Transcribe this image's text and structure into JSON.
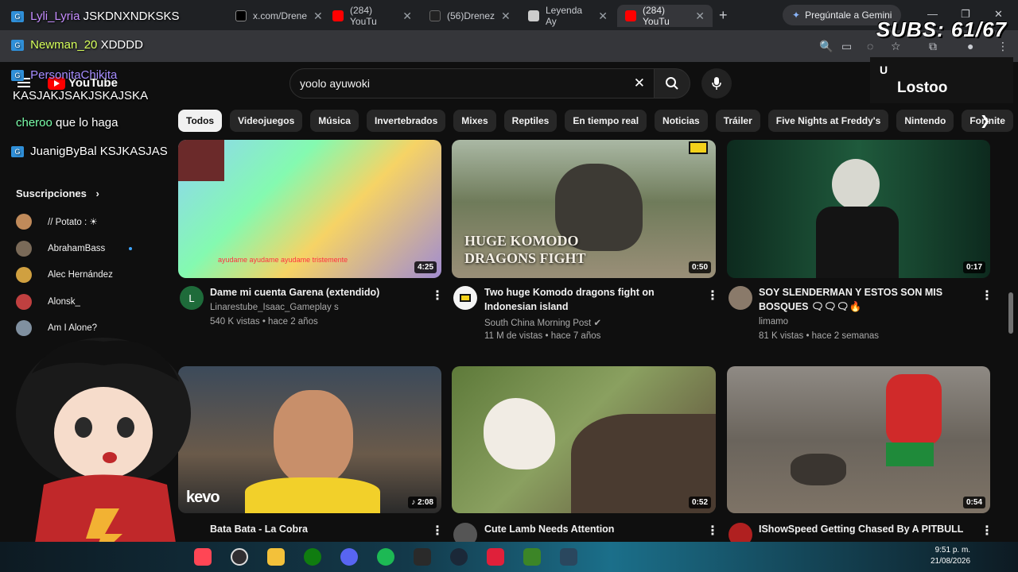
{
  "browser": {
    "tabs": [
      {
        "label": "x.com/Drene",
        "color": "#e8eaed"
      },
      {
        "label": "(284) YouTu",
        "color": "#ff0000"
      },
      {
        "label": "(56)Drenez",
        "color": "#222222"
      },
      {
        "label": "Leyenda Ay",
        "color": "#cccccc"
      },
      {
        "label": "(284) YouTu",
        "color": "#ff0000"
      }
    ],
    "gemini_label": "Pregúntale a Gemini"
  },
  "youtube": {
    "logo_text": "YouTube",
    "search": {
      "value": "yoolo ayuwoki"
    },
    "chips": [
      "Todos",
      "Videojuegos",
      "Música",
      "Invertebrados",
      "Mixes",
      "Reptiles",
      "En tiempo real",
      "Noticias",
      "Tráiler",
      "Five Nights at Freddy's",
      "Nintendo",
      "Fortnite"
    ],
    "sidebar": {
      "section_title": "Suscripciones",
      "subscriptions": [
        {
          "name": "// Potato : ☀",
          "color": "#c08a5a",
          "live": false
        },
        {
          "name": "AbrahamBass",
          "color": "#7a6a58",
          "live": true
        },
        {
          "name": "Alec Hernández",
          "color": "#d0a040",
          "live": false
        },
        {
          "name": "Alonsk_",
          "color": "#c04040",
          "live": false
        },
        {
          "name": "Am I Alone?",
          "color": "#8090a0",
          "live": false
        }
      ]
    },
    "videos": [
      {
        "title": "Dame mi cuenta Garena (extendido)",
        "channel": "Linarestube_Isaac_Gameplay s",
        "meta": "540 K vistas • hace 2 años",
        "duration": "4:25",
        "avatar_letter": "L",
        "avatar_color": "#1e6b3a",
        "thumb_caption": "ayudame ayudame ayudame tristemente"
      },
      {
        "title": "Two huge Komodo dragons fight on Indonesian island",
        "channel": "South China Morning Post ✔",
        "meta": "11 M de vistas • hace 7 años",
        "duration": "0:50",
        "avatar_letter": "",
        "avatar_color": "#f4f4f4",
        "overlay": "HUGE KOMODO\nDRAGONS FIGHT"
      },
      {
        "title": "SOY SLENDERMAN Y ESTOS SON MIS BOSQUES 🗨🗨🗨🔥",
        "channel": "limamo",
        "meta": "81 K vistas • hace 2 semanas",
        "duration": "0:17",
        "avatar_letter": "",
        "avatar_color": "#8a7a6a"
      },
      {
        "title": "Bata Bata - La Cobra",
        "channel": "",
        "meta": "",
        "duration": "♪ 2:08",
        "avatar_letter": "",
        "avatar_color": "#333333",
        "overlay": "kevo"
      },
      {
        "title": "Cute Lamb Needs Attention",
        "channel": "",
        "meta": "",
        "duration": "0:52",
        "avatar_letter": "",
        "avatar_color": "#555555"
      },
      {
        "title": "IShowSpeed Getting Chased By A PITBULL",
        "channel": "",
        "meta": "",
        "duration": "0:54",
        "avatar_letter": "",
        "avatar_color": "#b02020"
      }
    ]
  },
  "stream": {
    "subs_label": "SUBS: 61/67",
    "streamer_name": "Lostoo",
    "chat": [
      {
        "user": "Lyli_Lyria",
        "message": "JSKDNXNDKSKS",
        "user_color": "#c58cff"
      },
      {
        "user": "Newman_20",
        "message": "XDDDD",
        "user_color": "#d6ff5a"
      },
      {
        "user": "PersonitaChikita",
        "message": "",
        "user_color": "#a58cff"
      },
      {
        "user": "",
        "message": "KASJAKJSAKJSKAJSKA",
        "user_color": "#ffffff"
      },
      {
        "user": "cheroo",
        "message": "que lo haga",
        "user_color": "#7affaa"
      },
      {
        "user": "JuanigByBal",
        "message": "KSJKASJAS",
        "user_color": "#ffffff"
      }
    ]
  },
  "taskbar": {
    "time": "9:51 p. m.",
    "date": "21/08/2026",
    "apps": [
      {
        "name": "valorant-icon",
        "color": "#ff4655"
      },
      {
        "name": "obs-icon",
        "color": "#302e31"
      },
      {
        "name": "folder-icon",
        "color": "#f3c13a"
      },
      {
        "name": "xbox-icon",
        "color": "#107c10"
      },
      {
        "name": "discord-icon",
        "color": "#5865f2"
      },
      {
        "name": "spotify-icon",
        "color": "#1db954"
      },
      {
        "name": "epic-icon",
        "color": "#2a2a2a"
      },
      {
        "name": "steam-icon",
        "color": "#1b2838"
      },
      {
        "name": "x-icon",
        "color": "#e0203a"
      },
      {
        "name": "minecraft-icon",
        "color": "#3c8527"
      },
      {
        "name": "steam2-icon",
        "color": "#2a475e"
      }
    ]
  }
}
